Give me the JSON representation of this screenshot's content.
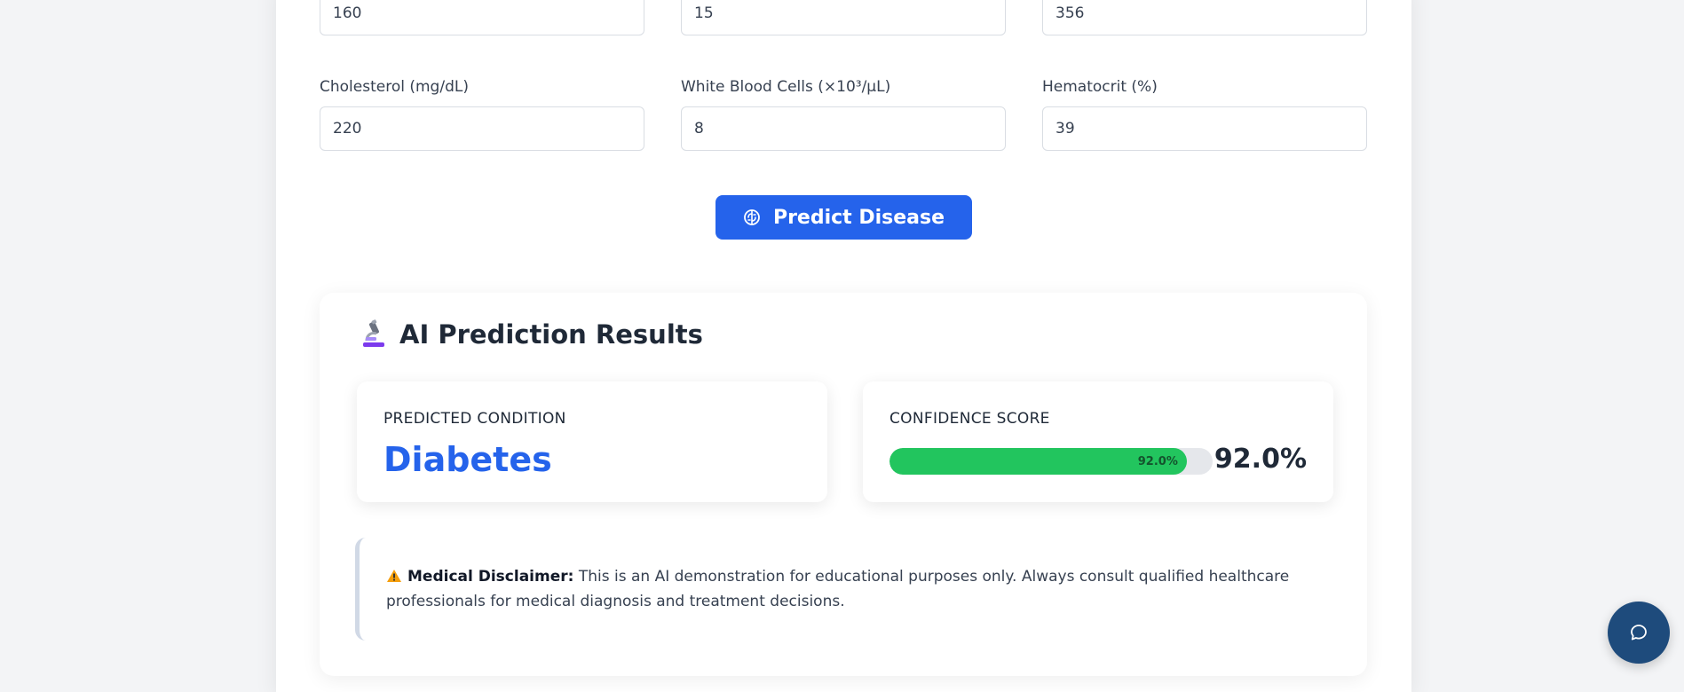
{
  "form": {
    "row1": [
      "160",
      "15",
      "356"
    ],
    "row2": [
      {
        "label": "Cholesterol (mg/dL)",
        "value": "220"
      },
      {
        "label": "White Blood Cells (×10³/μL)",
        "value": "8"
      },
      {
        "label": "Hematocrit (%)",
        "value": "39"
      }
    ],
    "predict_button": "Predict Disease",
    "predict_icon": "brain-icon"
  },
  "results": {
    "title": "AI Prediction Results",
    "title_icon": "microscope-icon",
    "predicted_condition_caption": "PREDICTED CONDITION",
    "predicted_condition": "Diabetes",
    "confidence_caption": "CONFIDENCE SCORE",
    "confidence_fraction": 0.92,
    "confidence_bar_label": "92.0%",
    "confidence_value": "92.0%",
    "disclaimer_icon": "warning-icon",
    "disclaimer_label": "Medical Disclaimer:",
    "disclaimer_text": "This is an AI demonstration for educational purposes only. Always consult qualified healthcare professionals for medical diagnosis and treatment decisions."
  },
  "chat": {
    "icon": "chat-icon"
  },
  "colors": {
    "primary": "#2563eb",
    "success": "#22c55e",
    "fab": "#1e4b7c"
  }
}
